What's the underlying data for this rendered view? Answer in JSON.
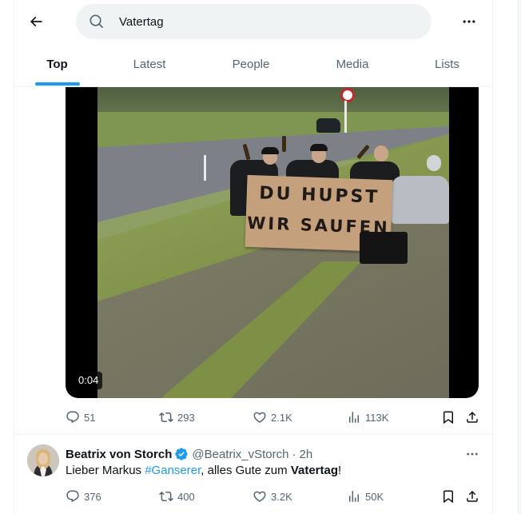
{
  "search": {
    "query": "Vatertag",
    "placeholder": "Search"
  },
  "tabs": [
    {
      "label": "Top",
      "active": true
    },
    {
      "label": "Latest",
      "active": false
    },
    {
      "label": "People",
      "active": false
    },
    {
      "label": "Media",
      "active": false
    },
    {
      "label": "Lists",
      "active": false
    }
  ],
  "video": {
    "timestamp": "0:04",
    "sign_line_1": "DU HUPST",
    "sign_line_2": "WIR SAUFEN"
  },
  "tweet1": {
    "replies": "51",
    "retweets": "293",
    "likes": "2.1K",
    "views": "113K"
  },
  "tweet2": {
    "name": "Beatrix von Storch",
    "handle": "@Beatrix_vStorch",
    "separator": "·",
    "time": "2h",
    "text_before": "Lieber Markus ",
    "hashtag": "#Ganserer",
    "text_middle": ", alles Gute zum ",
    "text_bold": "Vatertag",
    "text_after": "!",
    "replies": "376",
    "retweets": "400",
    "likes": "3.2K",
    "views": "50K"
  },
  "icons": {
    "back": "arrow-left-icon",
    "search": "search-icon",
    "more": "more-horizontal-icon",
    "reply": "reply-icon",
    "retweet": "retweet-icon",
    "like": "heart-icon",
    "views": "views-icon",
    "bookmark": "bookmark-icon",
    "share": "share-icon",
    "verified": "verified-badge-icon"
  },
  "colors": {
    "accent": "#1d9bf0",
    "text": "#0f1419",
    "secondary": "#536471",
    "search_bg": "#eff3f4"
  }
}
